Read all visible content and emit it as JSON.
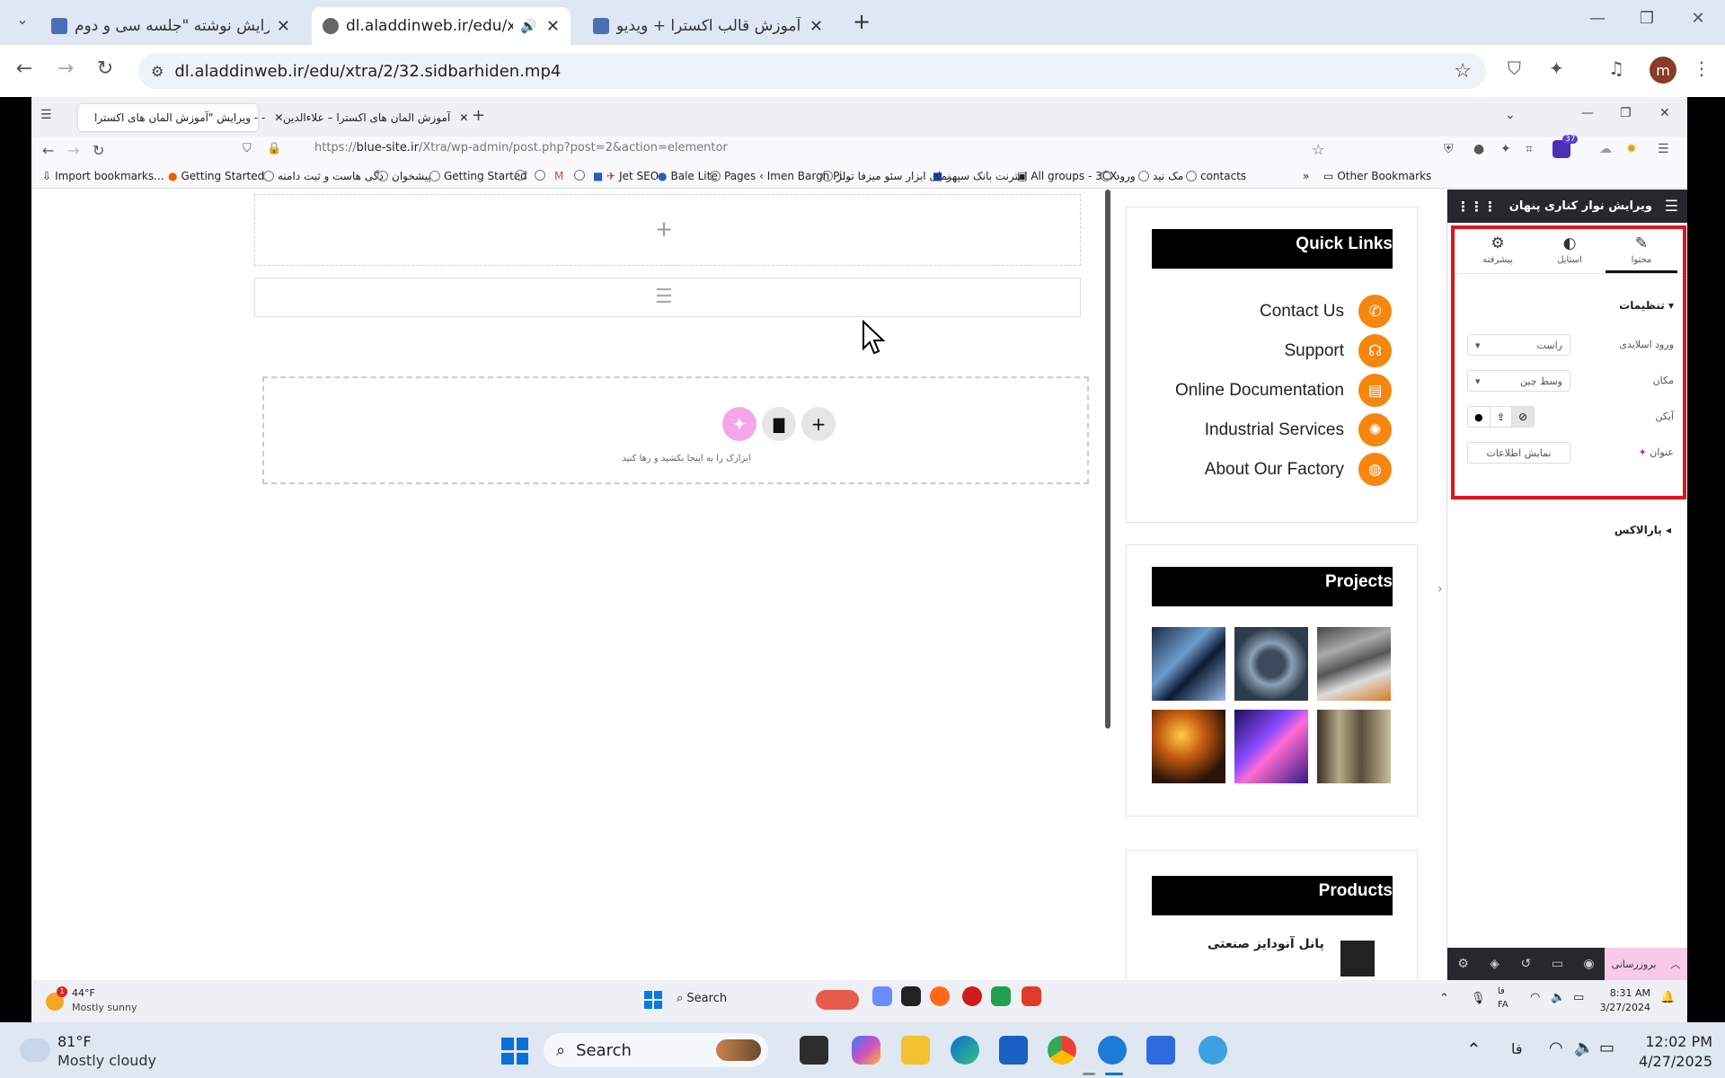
{
  "outer_browser": {
    "tabs": [
      {
        "title": "ویرایش نوشته \"جلسه سی و دوم -",
        "active": false
      },
      {
        "title": "dl.aladdinweb.ir/edu/xtra/2/",
        "active": true
      },
      {
        "title": "آموزش قالب اکسترا + ویدیو",
        "active": false
      }
    ],
    "url": "dl.aladdinweb.ir/edu/xtra/2/32.sidbarhiden.mp4",
    "profile_initial": "m"
  },
  "inner_browser": {
    "tabs": [
      {
        "title": "ویرایش \"آموزش المان های اکسترا - -",
        "active": true
      },
      {
        "title": "آموزش المان های اکسترا – علاءالدین",
        "active": false
      }
    ],
    "url_prefix": "https://",
    "url_host": "blue-site.ir",
    "url_path": "/Xtra/wp-admin/post.php?post=2&action=elementor",
    "extension_badge": "37",
    "bookmarks": [
      "Import bookmarks...",
      "Getting Started",
      "دگی هاست و ثبت دامنه",
      "پیشخوان",
      "Getting Started",
      "Jet SEO",
      "Bale Lite",
      "Pages ‹ Imen Bargh Pi...",
      "نمای ابزار سئو میزفا تولز",
      "اینترنت بانک سپهر",
      "All groups - 3CX",
      "ورود",
      "مک نید",
      "contacts"
    ],
    "other_bookmarks": "Other Bookmarks"
  },
  "canvas": {
    "drop_hint": "ابزارک را به اینجا بکشید و رها کنید"
  },
  "sidebar": {
    "quick_links": {
      "title": "Quick Links",
      "items": [
        {
          "label": "Contact Us",
          "icon": "phone-icon"
        },
        {
          "label": "Support",
          "icon": "headset-icon"
        },
        {
          "label": "Online Documentation",
          "icon": "document-icon"
        },
        {
          "label": "Industrial Services",
          "icon": "gear-icon"
        },
        {
          "label": "About Our Factory",
          "icon": "globe-icon"
        }
      ]
    },
    "projects": {
      "title": "Projects",
      "count": 6
    },
    "products": {
      "title": "Products",
      "first_item": "پانل آنودایز صنعتی"
    }
  },
  "panel": {
    "title": "ویرایش نوار کناری پنهان",
    "tabs": [
      {
        "label": "محتوا",
        "icon": "pencil-icon"
      },
      {
        "label": "استایل",
        "icon": "contrast-icon"
      },
      {
        "label": "پیشرفته",
        "icon": "gear-icon"
      }
    ],
    "section_settings": "تنظیمات",
    "fields": {
      "entry_label": "ورود اسلایدی",
      "entry_value": "راست",
      "position_label": "مکان",
      "position_value": "وسط چین",
      "icon_label": "آیکن",
      "heading_label": "عنوان",
      "heading_placeholder": "نمایش اطلاعات"
    },
    "section_parallax": "پارالاکس",
    "update_button": "بروزرسانی"
  },
  "inner_taskbar": {
    "weather_temp": "44°F",
    "weather_desc": "Mostly sunny",
    "weather_badge": "1",
    "search": "Search",
    "lang": "فا",
    "lang2": "FA",
    "time": "8:31 AM",
    "date": "3/27/2024"
  },
  "taskbar": {
    "weather_temp": "81°F",
    "weather_desc": "Mostly cloudy",
    "search": "Search",
    "lang": "فا",
    "time": "12:02 PM",
    "date": "4/27/2025"
  },
  "colors": {
    "accent_orange": "#f7860f",
    "panel_dark": "#27282c",
    "highlight_red": "#e0151c",
    "update_pink": "#f9c9e9"
  }
}
